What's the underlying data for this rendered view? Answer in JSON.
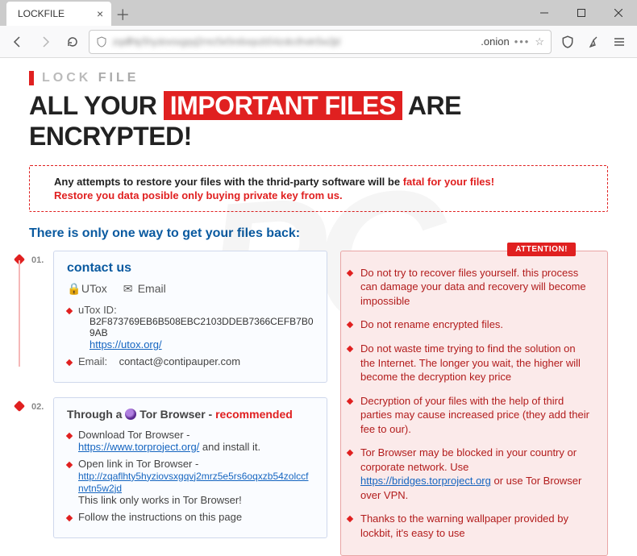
{
  "window": {
    "tab_title": "LOCKFILE",
    "url_suffix": ".onion",
    "url_blur": "zqaflhty5hyziovsxgqvj2mrz5e5rs6oqxzb54zolccfnvtn5w2jd"
  },
  "brand": {
    "lock": "LOCK",
    "file": "FILE"
  },
  "headline": {
    "pre": "ALL YOUR",
    "highlight": "IMPORTANT FILES",
    "post": "ARE ENCRYPTED!"
  },
  "alert": {
    "line1_a": "Any attempts to restore your files with the thrid-party software will be ",
    "line1_b": "fatal for your files!",
    "line2": "Restore you data posible only buying private key from us."
  },
  "subhead": "There is only one way to get your files back:",
  "steps": {
    "s1": "01.",
    "s2": "02."
  },
  "contact": {
    "title": "contact us",
    "utox_tab": "UTox",
    "email_tab": "Email",
    "utox_label": "uTox ID:",
    "utox_id": "B2F873769EB6B508EBC2103DDEB7366CEFB7B09AB",
    "utox_link": "https://utox.org/",
    "email_label": "Email:",
    "email": "contact@contipauper.com"
  },
  "tor": {
    "through_a": "Through a ",
    "through_b": "Tor Browser - ",
    "recommended": "recommended",
    "dl_a": "Download Tor Browser - ",
    "dl_link": "https://www.torproject.org/",
    "dl_b": " and install it.",
    "open_a": "Open link in Tor Browser -",
    "open_link": "http://zqaflhty5hyziovsxgqvj2mrz5e5rs6oqxzb54zolccfnvtn5w2jd",
    "open_b": "This link only works in Tor Browser!",
    "follow": "Follow the instructions on this page"
  },
  "attention": {
    "badge": "ATTENTION!",
    "items": [
      "Do not try to recover files yourself. this process can damage your data and recovery will become impossible",
      "Do not rename encrypted files.",
      "Do not waste time trying to find the solution on the Internet. The longer you wait, the higher will become the decryption key price",
      "Decryption of your files with the help of third parties may cause increased price (they add their fee to our).",
      "Tor Browser may be blocked in your country or corporate network. Use |LINK| or use Tor Browser over VPN.",
      "Thanks to the warning wallpaper provided by lockbit, it's easy to use"
    ],
    "bridges_link": "https://bridges.torproject.org"
  }
}
